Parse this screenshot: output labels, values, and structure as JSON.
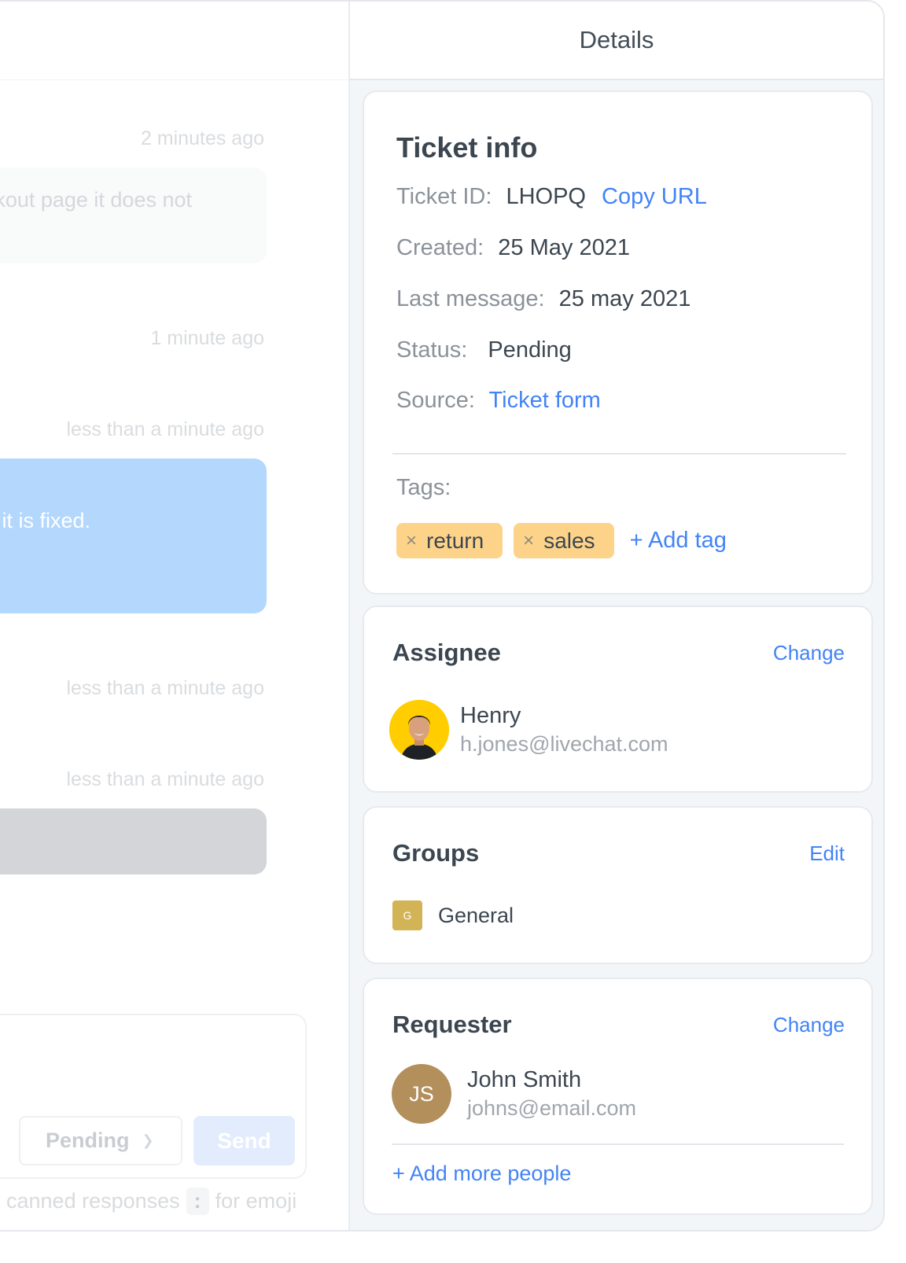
{
  "chat": {
    "messages": [
      {
        "timestamp": "2 minutes ago",
        "text": "eckout page it does not",
        "type": "customer"
      },
      {
        "timestamp": "1 minute ago",
        "text": "",
        "type": "system"
      },
      {
        "timestamp": "less than a minute ago",
        "text": "as it is fixed.",
        "type": "agent"
      },
      {
        "timestamp": "less than a minute ago",
        "text": "",
        "type": "system"
      },
      {
        "timestamp": "less than a minute ago",
        "text": "",
        "type": "note"
      }
    ],
    "composer": {
      "status_value": "Pending",
      "send_label": "Send",
      "hint_prefix": "canned responses",
      "hint_key": ":",
      "hint_suffix": "for emoji"
    }
  },
  "details": {
    "title": "Details",
    "ticket_info": {
      "title": "Ticket info",
      "ticket_id_label": "Ticket ID:",
      "ticket_id": "LHOPQ",
      "copy_url_label": "Copy URL",
      "created_label": "Created:",
      "created": "25 May 2021",
      "last_message_label": "Last message:",
      "last_message": "25 may 2021",
      "status_label": "Status:",
      "status": "Pending",
      "source_label": "Source:",
      "source": "Ticket form",
      "tags_label": "Tags:",
      "tags": [
        {
          "label": "return",
          "remove_icon": "×"
        },
        {
          "label": "sales",
          "remove_icon": "×"
        }
      ],
      "add_tag_label": "+ Add tag"
    },
    "assignee": {
      "title": "Assignee",
      "action_label": "Change",
      "name": "Henry",
      "email": "h.jones@livechat.com"
    },
    "groups": {
      "title": "Groups",
      "action_label": "Edit",
      "items": [
        {
          "initial": "G",
          "name": "General"
        }
      ]
    },
    "requester": {
      "title": "Requester",
      "action_label": "Change",
      "initials": "JS",
      "name": "John Smith",
      "email": "johns@email.com",
      "add_more_label": "+ Add more people"
    }
  },
  "colors": {
    "accent": "#4384f5",
    "tag_bg": "#fdd38a",
    "group_badge": "#d2b356",
    "requester_avatar": "#b38f5c",
    "assignee_avatar_bg": "#ffcd00",
    "agent_bubble": "#b3d7fd",
    "panel_bg": "#f3f6f9"
  }
}
